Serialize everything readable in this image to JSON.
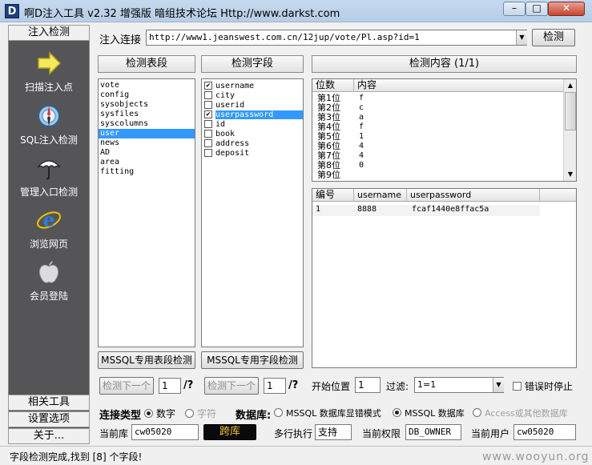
{
  "window": {
    "title": "啊D注入工具 v2.32 增强版 暗组技术论坛 Http://www.darkst.com",
    "icon_letter": "D",
    "controls": [
      "–",
      "□",
      "✕"
    ]
  },
  "sidebar": {
    "header": "注入检测",
    "items": [
      {
        "label": "扫描注入点",
        "icon": "arrow-right-icon"
      },
      {
        "label": "SQL注入检测",
        "icon": "compass-icon"
      },
      {
        "label": "管理入口检测",
        "icon": "umbrella-icon"
      },
      {
        "label": "浏览网页",
        "icon": "ie-browser-icon"
      },
      {
        "label": "会员登陆",
        "icon": "apple-icon"
      }
    ],
    "bottom": [
      "相关工具",
      "设置选项",
      "关于..."
    ]
  },
  "url_bar": {
    "label": "注入连接",
    "value": "http://www1.jeanswest.com.cn/12jup/vote/Pl.asp?id=1",
    "detect_button": "检测"
  },
  "tables_panel": {
    "header": "检测表段",
    "items": [
      "vote",
      "config",
      "sysobjects",
      "sysfiles",
      "syscolumns",
      "user",
      "news",
      "AD",
      "area",
      "fitting"
    ],
    "selected_index": 5,
    "mssql_button": "MSSQL专用表段检测",
    "next_button": "检测下一个",
    "count_value": "1",
    "count_suffix": "/?"
  },
  "fields_panel": {
    "header": "检测字段",
    "items": [
      {
        "label": "username",
        "checked": true
      },
      {
        "label": "city",
        "checked": false
      },
      {
        "label": "userid",
        "checked": false
      },
      {
        "label": "userpassword",
        "checked": true
      },
      {
        "label": "id",
        "checked": false
      },
      {
        "label": "book",
        "checked": false
      },
      {
        "label": "address",
        "checked": false
      },
      {
        "label": "deposit",
        "checked": false
      }
    ],
    "selected_index": 3,
    "mssql_button": "MSSQL专用字段检测",
    "next_button": "检测下一个",
    "count_value": "1",
    "count_suffix": "/?"
  },
  "content_panel": {
    "header": "检测内容 (1/1)",
    "digit_columns": [
      "位数",
      "内容"
    ],
    "digit_rows": [
      [
        "第1位",
        "f"
      ],
      [
        "第2位",
        "c"
      ],
      [
        "第3位",
        "a"
      ],
      [
        "第4位",
        "f"
      ],
      [
        "第5位",
        "1"
      ],
      [
        "第6位",
        "4"
      ],
      [
        "第7位",
        "4"
      ],
      [
        "第8位",
        "0"
      ],
      [
        "第9位",
        ""
      ]
    ],
    "result_columns": [
      "编号",
      "username",
      "userpassword"
    ],
    "result_rows": [
      [
        "1",
        "8888",
        "fcaf1440e8ffac5a"
      ]
    ]
  },
  "options": {
    "start_label": "开始位置",
    "start_value": "1",
    "filter_label": "过滤:",
    "filter_value": "1=1",
    "stop_on_error_label": "错误时停止",
    "conn_type_label": "连接类型",
    "conn_numeric": "数字",
    "conn_char": "字符",
    "db_label": "数据库:",
    "db_mssql_error": "MSSQL 数据库显错模式",
    "db_mssql": "MSSQL 数据库",
    "db_access": "Access或其他数据库",
    "current_db_label": "当前库",
    "current_db_value": "cw05020",
    "cross_db_button": "跨库",
    "multiline_label": "多行执行",
    "multiline_value": "支持",
    "current_perm_label": "当前权限",
    "current_perm_value": "DB_OWNER",
    "current_user_label": "当前用户",
    "current_user_value": "cw05020"
  },
  "status": {
    "text": "字段检测完成,找到 [8] 个字段!",
    "watermark": "www.wooyun.org"
  }
}
